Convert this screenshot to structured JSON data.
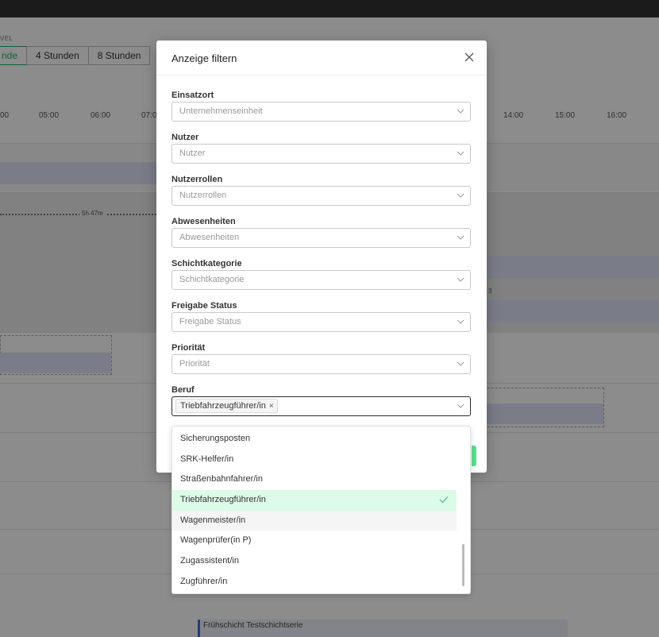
{
  "background": {
    "level_label": "VEL",
    "granularity": [
      "nde",
      "4 Stunden",
      "8 Stunden"
    ],
    "active_granularity": "nde",
    "time_labels": [
      "00",
      "05:00",
      "06:00",
      "07:0",
      "14:00",
      "15:00",
      "16:00"
    ],
    "duration_label": "5h 47m",
    "side_mark": "3",
    "shift_label": "Frühschicht Testschichtserie"
  },
  "modal": {
    "title": "Anzeige filtern",
    "fields": [
      {
        "label": "Einsatzort",
        "placeholder": "Unternehmenseinheit"
      },
      {
        "label": "Nutzer",
        "placeholder": "Nutzer"
      },
      {
        "label": "Nutzerrollen",
        "placeholder": "Nutzerrollen"
      },
      {
        "label": "Abwesenheiten",
        "placeholder": "Abwesenheiten"
      },
      {
        "label": "Schichtkategorie",
        "placeholder": "Schichtkategorie"
      },
      {
        "label": "Freigabe Status",
        "placeholder": "Freigabe Status"
      },
      {
        "label": "Priorität",
        "placeholder": "Priorität"
      }
    ],
    "beruf": {
      "label": "Beruf",
      "selected_tag": "Triebfahrzeugführer/in",
      "tag_remove": "×"
    }
  },
  "dropdown": {
    "options": [
      "Sicherungsposten",
      "SRK-Helfer/in",
      "Straßenbahnfahrer/in",
      "Triebfahrzeugführer/in",
      "Wagenmeister/in",
      "Wagenprüfer(in P)",
      "Zugassistent/in",
      "Zugführer/in"
    ],
    "selected_index": 3,
    "hover_index": 4
  },
  "colors": {
    "accent_green": "#1db75f",
    "selected_bg": "#dcfbe8",
    "bar_blue": "#dfe3f7"
  }
}
